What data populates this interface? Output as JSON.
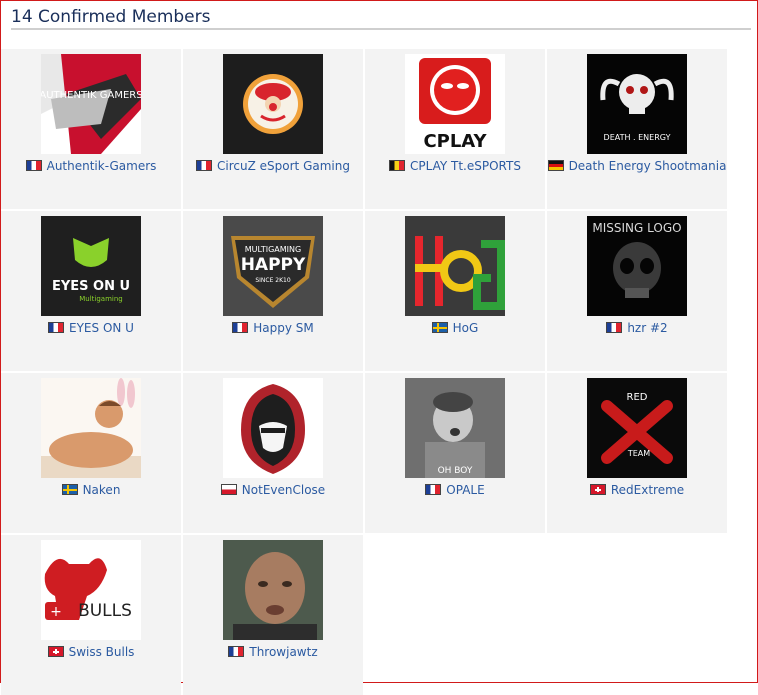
{
  "header": {
    "title": "14 Confirmed Members"
  },
  "members": [
    {
      "name": "Authentik-Gamers",
      "flag": "france",
      "logo_text": "AUTHENTIK GAMERS"
    },
    {
      "name": "CircuZ eSport Gaming",
      "flag": "france",
      "logo_text": ""
    },
    {
      "name": "CPLAY Tt.eSPORTS",
      "flag": "belgium",
      "logo_text": "CPLAY"
    },
    {
      "name": "Death Energy Shootmania",
      "flag": "germany",
      "logo_text": "DEATH . ENERGY"
    },
    {
      "name": "EYES ON U",
      "flag": "france",
      "logo_text": "EYES ON U",
      "logo_subtext": "Multigaming"
    },
    {
      "name": "Happy SM",
      "flag": "france",
      "logo_text": "HAPPY",
      "logo_subtext": "MULTIGAMING",
      "logo_since": "SINCE 2K10"
    },
    {
      "name": "HoG",
      "flag": "sweden",
      "logo_text": "HoG"
    },
    {
      "name": "hzr #2",
      "flag": "france",
      "logo_text": "MISSING LOGO"
    },
    {
      "name": "Naken",
      "flag": "sweden",
      "logo_text": ""
    },
    {
      "name": "NotEvenClose",
      "flag": "poland",
      "logo_text": ""
    },
    {
      "name": "OPALE",
      "flag": "france",
      "logo_text": "OH BOY"
    },
    {
      "name": "RedExtreme",
      "flag": "switzerland",
      "logo_text": "RED",
      "logo_subtext": "TEAM"
    },
    {
      "name": "Swiss Bulls",
      "flag": "switzerland",
      "logo_text": "BULLS"
    },
    {
      "name": "Throwjawtz",
      "flag": "france",
      "logo_text": ""
    }
  ]
}
